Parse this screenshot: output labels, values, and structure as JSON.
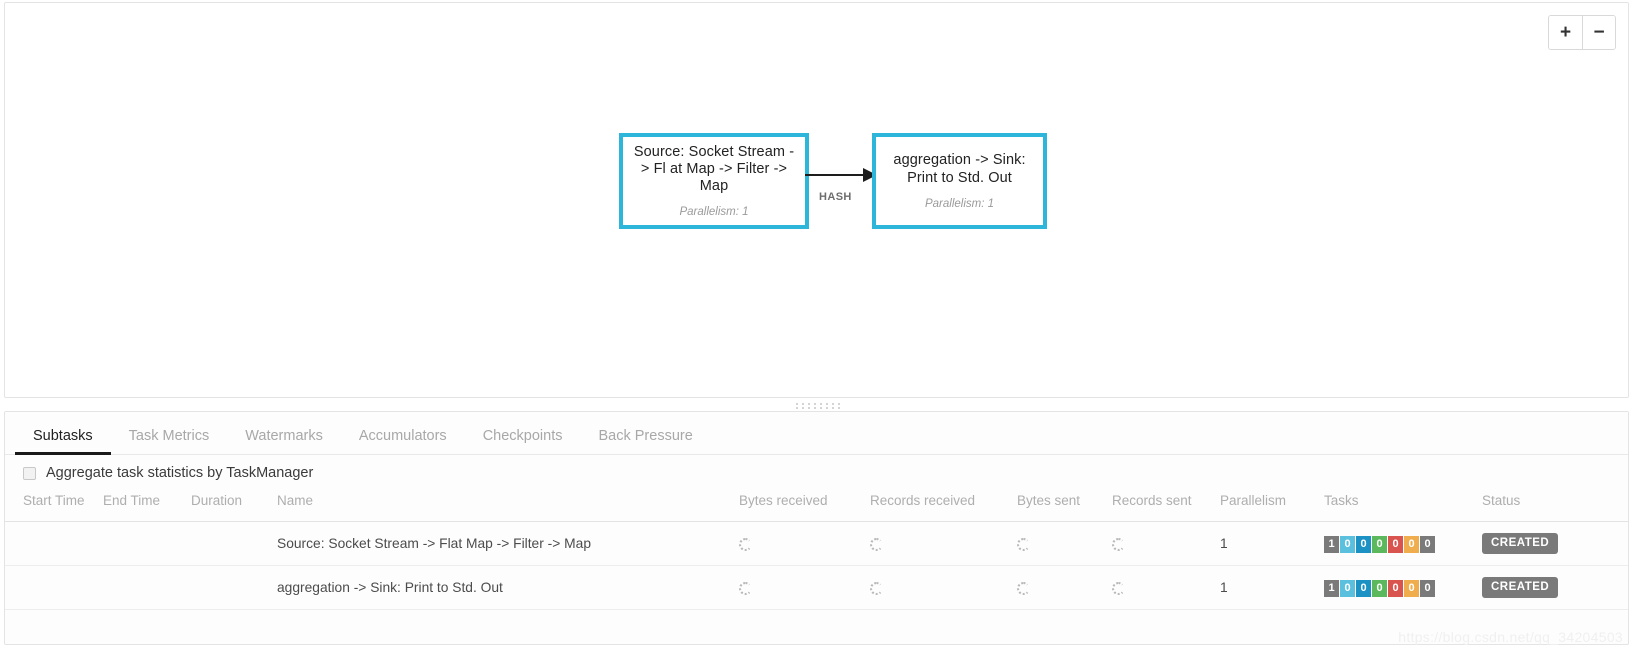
{
  "graph": {
    "zoom_in_label": "+",
    "zoom_out_label": "−",
    "nodes": [
      {
        "id": "node-0",
        "title": "Source: Socket Stream -> Fl at Map -> Filter -> Map",
        "subtitle": "Parallelism: 1",
        "border_color": "#2db6d9"
      },
      {
        "id": "node-1",
        "title": "aggregation -> Sink: Print to Std. Out",
        "subtitle": "Parallelism: 1",
        "border_color": "#2db6d9"
      }
    ],
    "edges": [
      {
        "label": "HASH",
        "from": "node-0",
        "to": "node-1"
      }
    ]
  },
  "tabs": [
    {
      "label": "Subtasks",
      "active": true
    },
    {
      "label": "Task Metrics",
      "active": false
    },
    {
      "label": "Watermarks",
      "active": false
    },
    {
      "label": "Accumulators",
      "active": false
    },
    {
      "label": "Checkpoints",
      "active": false
    },
    {
      "label": "Back Pressure",
      "active": false
    }
  ],
  "aggregate": {
    "label": "Aggregate task statistics by TaskManager",
    "checked": false
  },
  "table": {
    "columns": [
      "Start Time",
      "End Time",
      "Duration",
      "Name",
      "Bytes received",
      "Records received",
      "Bytes sent",
      "Records sent",
      "Parallelism",
      "Tasks",
      "Status"
    ],
    "rows": [
      {
        "start_time": "",
        "end_time": "",
        "duration": "",
        "name": "Source: Socket Stream -> Flat Map -> Filter -> Map",
        "bytes_received": "loading-spinner",
        "records_received": "loading-spinner",
        "bytes_sent": "loading-spinner",
        "records_sent": "loading-spinner",
        "parallelism": "1",
        "tasks": [
          {
            "value": "1",
            "color": "#7a7a7a"
          },
          {
            "value": "0",
            "color": "#5bc0de"
          },
          {
            "value": "0",
            "color": "#1b91c4"
          },
          {
            "value": "0",
            "color": "#5cb85c"
          },
          {
            "value": "0",
            "color": "#d9534f"
          },
          {
            "value": "0",
            "color": "#f0ad4e"
          },
          {
            "value": "0",
            "color": "#7a7a7a"
          }
        ],
        "status": "CREATED"
      },
      {
        "start_time": "",
        "end_time": "",
        "duration": "",
        "name": "aggregation -> Sink: Print to Std. Out",
        "bytes_received": "loading-spinner",
        "records_received": "loading-spinner",
        "bytes_sent": "loading-spinner",
        "records_sent": "loading-spinner",
        "parallelism": "1",
        "tasks": [
          {
            "value": "1",
            "color": "#7a7a7a"
          },
          {
            "value": "0",
            "color": "#5bc0de"
          },
          {
            "value": "0",
            "color": "#1b91c4"
          },
          {
            "value": "0",
            "color": "#5cb85c"
          },
          {
            "value": "0",
            "color": "#d9534f"
          },
          {
            "value": "0",
            "color": "#f0ad4e"
          },
          {
            "value": "0",
            "color": "#7a7a7a"
          }
        ],
        "status": "CREATED"
      }
    ]
  },
  "watermark": "https://blog.csdn.net/qq_34204503"
}
